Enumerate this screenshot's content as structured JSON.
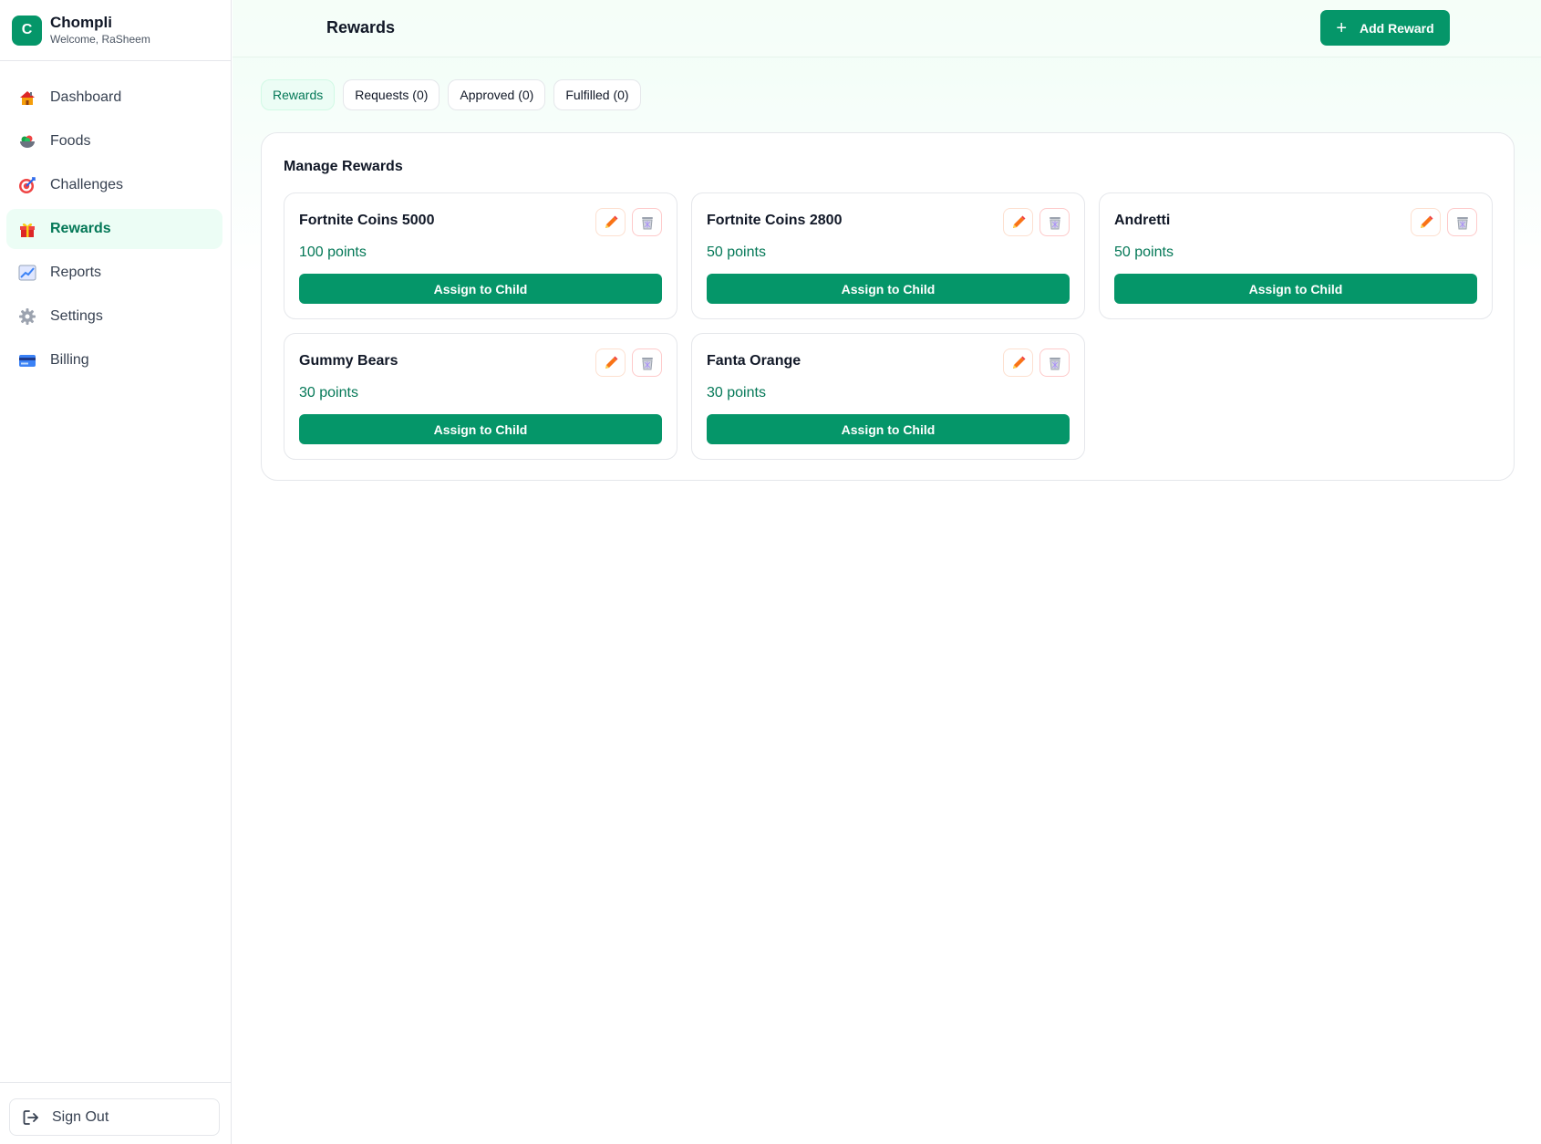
{
  "brand": {
    "logo_letter": "C",
    "name": "Chompli",
    "welcome": "Welcome, RaSheem"
  },
  "sidebar": {
    "items": [
      {
        "label": "Dashboard",
        "icon": "house-icon"
      },
      {
        "label": "Foods",
        "icon": "salad-bowl-icon"
      },
      {
        "label": "Challenges",
        "icon": "target-icon"
      },
      {
        "label": "Rewards",
        "icon": "gift-icon",
        "active": true
      },
      {
        "label": "Reports",
        "icon": "chart-icon"
      },
      {
        "label": "Settings",
        "icon": "gear-icon"
      },
      {
        "label": "Billing",
        "icon": "credit-card-icon"
      }
    ],
    "sign_out": "Sign Out"
  },
  "header": {
    "title": "Rewards",
    "add_button": "Add Reward"
  },
  "tabs": [
    {
      "label": "Rewards",
      "active": true
    },
    {
      "label": "Requests (0)"
    },
    {
      "label": "Approved (0)"
    },
    {
      "label": "Fulfilled (0)"
    }
  ],
  "panel": {
    "title": "Manage Rewards",
    "assign_label": "Assign to Child",
    "rewards": [
      {
        "name": "Fortnite Coins 5000",
        "points": "100 points"
      },
      {
        "name": "Fortnite Coins 2800",
        "points": "50 points"
      },
      {
        "name": "Andretti",
        "points": "50 points"
      },
      {
        "name": "Gummy Bears",
        "points": "30 points"
      },
      {
        "name": "Fanta Orange",
        "points": "30 points"
      }
    ]
  },
  "colors": {
    "brand": "#059669",
    "accent_text": "#047857",
    "active_bg": "#ecfdf5",
    "edit_icon": "#f97316",
    "delete_icon": "#9ca3af"
  }
}
